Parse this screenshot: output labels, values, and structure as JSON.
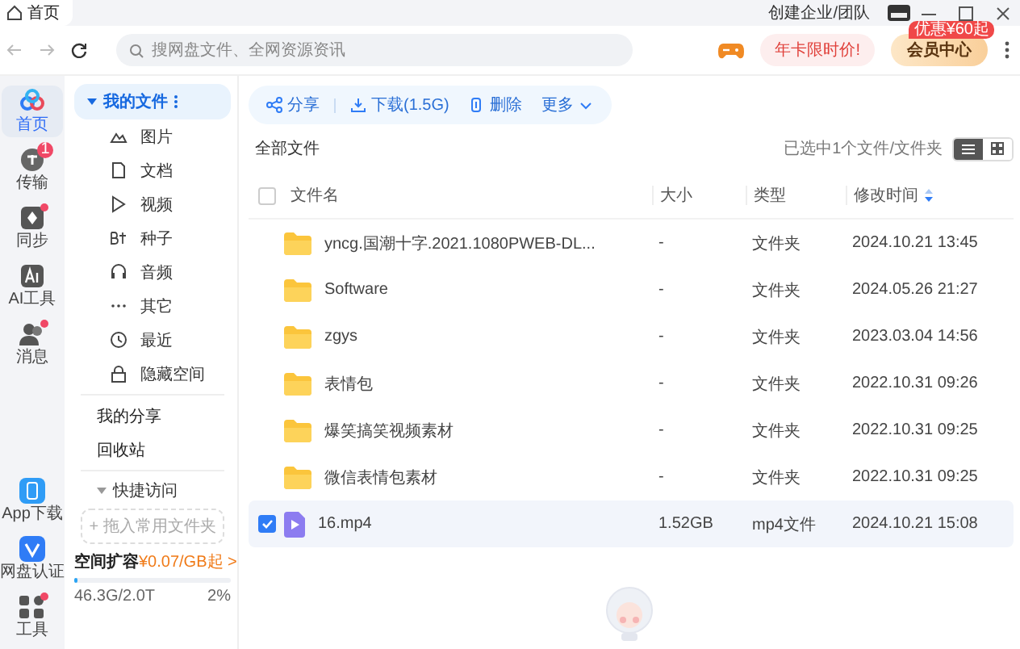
{
  "title_bar": {
    "tab": "首页",
    "create_team": "创建企业/团队"
  },
  "nav_bar": {
    "search": {
      "placeholder": "搜网盘文件、全网资源资讯"
    },
    "promo": "年卡限时价!",
    "vip": {
      "label": "会员中心",
      "badge": "优惠¥60起"
    }
  },
  "rail": {
    "top": [
      {
        "kind": "home",
        "label": "首页",
        "selected": true,
        "notify": false
      },
      {
        "kind": "transfer",
        "label": "传输",
        "selected": false,
        "notify": false,
        "badge": "1"
      },
      {
        "kind": "sync",
        "label": "同步",
        "selected": false,
        "notify": true
      },
      {
        "kind": "ai",
        "label": "AI工具",
        "selected": false,
        "notify": false
      },
      {
        "kind": "message",
        "label": "消息",
        "selected": false,
        "notify": true
      }
    ],
    "bottom": [
      {
        "kind": "app",
        "label": "App下载",
        "selected": false,
        "notify": false
      },
      {
        "kind": "verify",
        "label": "网盘认证",
        "selected": false,
        "notify": false
      },
      {
        "kind": "tools",
        "label": "工具",
        "selected": false,
        "notify": true
      }
    ]
  },
  "sidebar": {
    "my_files": {
      "label": "我的文件",
      "selected": true,
      "expanded": true,
      "categories": [
        {
          "kind": "image",
          "label": "图片",
          "selected": false
        },
        {
          "kind": "doc",
          "label": "文档",
          "selected": false
        },
        {
          "kind": "video",
          "label": "视频",
          "selected": false
        },
        {
          "kind": "bt",
          "label": "种子",
          "selected": false
        },
        {
          "kind": "audio",
          "label": "音频",
          "selected": false
        },
        {
          "kind": "other",
          "label": "其它",
          "selected": false
        },
        {
          "kind": "recent",
          "label": "最近",
          "selected": false
        },
        {
          "kind": "hidden",
          "label": "隐藏空间",
          "selected": false
        }
      ]
    },
    "links": [
      {
        "label": "我的分享",
        "selected": false
      },
      {
        "label": "回收站",
        "selected": false
      }
    ],
    "quick_access": {
      "label": "快捷访问",
      "expanded": true,
      "drop_hint": "+ 拖入常用文件夹"
    },
    "storage": {
      "title": "空间扩容",
      "offer": "¥0.07/GB起 >",
      "usage": "46.3G/2.0T",
      "percent": "2%",
      "level": 0.02
    }
  },
  "toolbar": [
    {
      "kind": "share",
      "label": "分享"
    },
    {
      "kind": "download",
      "label": "下载(1.5G)"
    },
    {
      "kind": "delete",
      "label": "删除"
    },
    {
      "kind": "more",
      "label": "更多"
    }
  ],
  "breadcrumb": "全部文件",
  "selection_info": "已选中1个文件/文件夹",
  "view_modes": [
    {
      "kind": "list",
      "selected": true
    },
    {
      "kind": "grid",
      "selected": false
    }
  ],
  "table": {
    "all_checked": false,
    "columns": [
      {
        "label": "文件名",
        "sorted": false
      },
      {
        "label": "大小",
        "sorted": false
      },
      {
        "label": "类型",
        "sorted": false
      },
      {
        "label": "修改时间",
        "sorted": true
      }
    ],
    "rows": [
      {
        "kind": "folder",
        "name": "yncg.国潮十字.2021.1080PWEB-DL...",
        "size": "-",
        "type": "文件夹",
        "modified": "2024.10.21 13:45",
        "selected": false
      },
      {
        "kind": "folder",
        "name": "Software",
        "size": "-",
        "type": "文件夹",
        "modified": "2024.05.26 21:27",
        "selected": false
      },
      {
        "kind": "folder",
        "name": "zgys",
        "size": "-",
        "type": "文件夹",
        "modified": "2023.03.04 14:56",
        "selected": false
      },
      {
        "kind": "folder",
        "name": "表情包",
        "size": "-",
        "type": "文件夹",
        "modified": "2022.10.31 09:26",
        "selected": false
      },
      {
        "kind": "folder",
        "name": "爆笑搞笑视频素材",
        "size": "-",
        "type": "文件夹",
        "modified": "2022.10.31 09:25",
        "selected": false
      },
      {
        "kind": "folder",
        "name": "微信表情包素材",
        "size": "-",
        "type": "文件夹",
        "modified": "2022.10.31 09:25",
        "selected": false
      },
      {
        "kind": "video",
        "name": "16.mp4",
        "size": "1.52GB",
        "type": "mp4文件",
        "modified": "2024.10.21 15:08",
        "selected": true
      }
    ]
  }
}
